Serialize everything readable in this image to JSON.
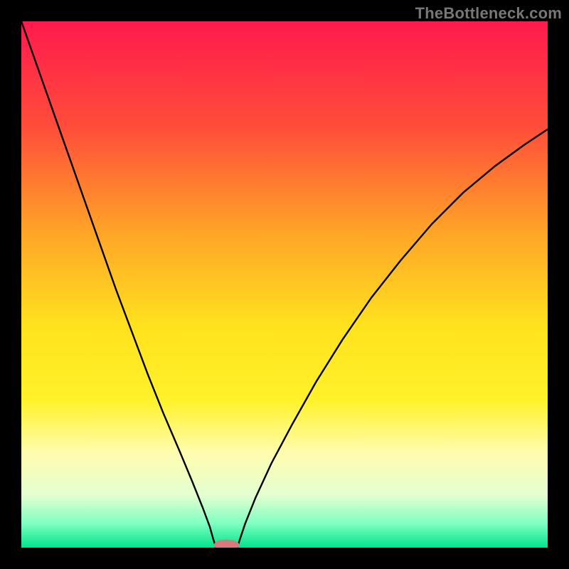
{
  "watermark": {
    "text": "TheBottleneck.com"
  },
  "chart_data": {
    "type": "line",
    "title": "",
    "xlabel": "",
    "ylabel": "",
    "xlim": [
      0,
      1
    ],
    "ylim": [
      0,
      1
    ],
    "grid": false,
    "background_gradient_stops": [
      {
        "pos": 0.0,
        "color": "#ff1a4d"
      },
      {
        "pos": 0.2,
        "color": "#ff4d3a"
      },
      {
        "pos": 0.4,
        "color": "#ffa427"
      },
      {
        "pos": 0.58,
        "color": "#ffe21e"
      },
      {
        "pos": 0.72,
        "color": "#fff22a"
      },
      {
        "pos": 0.82,
        "color": "#fffcb0"
      },
      {
        "pos": 0.9,
        "color": "#e4ffd0"
      },
      {
        "pos": 0.955,
        "color": "#7cffc0"
      },
      {
        "pos": 1.0,
        "color": "#00e38a"
      }
    ],
    "series": [
      {
        "name": "left-branch",
        "x": [
          0.0,
          0.03,
          0.06,
          0.09,
          0.12,
          0.15,
          0.18,
          0.21,
          0.24,
          0.27,
          0.3,
          0.325,
          0.345,
          0.358,
          0.365,
          0.37
        ],
        "y": [
          1.0,
          0.915,
          0.83,
          0.745,
          0.66,
          0.575,
          0.49,
          0.41,
          0.33,
          0.255,
          0.185,
          0.125,
          0.075,
          0.04,
          0.015,
          0.0
        ]
      },
      {
        "name": "right-branch",
        "x": [
          0.41,
          0.415,
          0.425,
          0.445,
          0.475,
          0.515,
          0.56,
          0.61,
          0.665,
          0.72,
          0.78,
          0.84,
          0.9,
          0.955,
          1.0
        ],
        "y": [
          0.0,
          0.015,
          0.045,
          0.095,
          0.16,
          0.235,
          0.315,
          0.395,
          0.475,
          0.545,
          0.615,
          0.675,
          0.725,
          0.765,
          0.795
        ]
      }
    ],
    "marker": {
      "name": "min-marker",
      "x": 0.39,
      "y": 0.0,
      "rx": 0.024,
      "ry": 0.01,
      "fill": "#d87a7a"
    }
  }
}
